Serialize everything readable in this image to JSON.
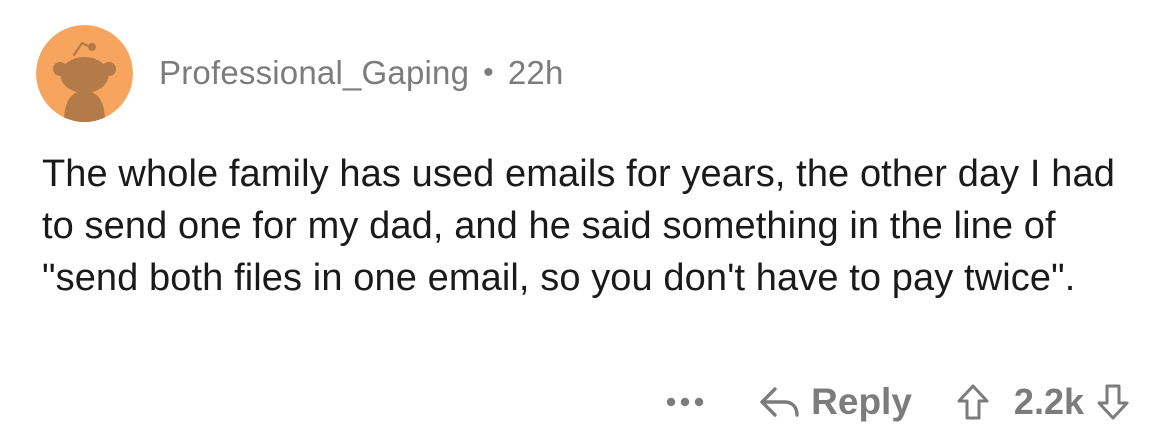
{
  "comment": {
    "username": "Professional_Gaping",
    "separator": "•",
    "time": "22h",
    "avatar_icon": "snoo-avatar-icon",
    "avatar_color": "#f4a261",
    "text": "The whole family has used emails for years, the other day I had to send one for my dad, and he said something in the line of \"send both files in one email, so you don't have to pay twice\"."
  },
  "actions": {
    "more_icon": "ellipsis-icon",
    "reply_icon": "reply-arrow-icon",
    "reply_label": "Reply",
    "upvote_icon": "arrow-up-icon",
    "score": "2.2k",
    "downvote_icon": "arrow-down-icon"
  }
}
